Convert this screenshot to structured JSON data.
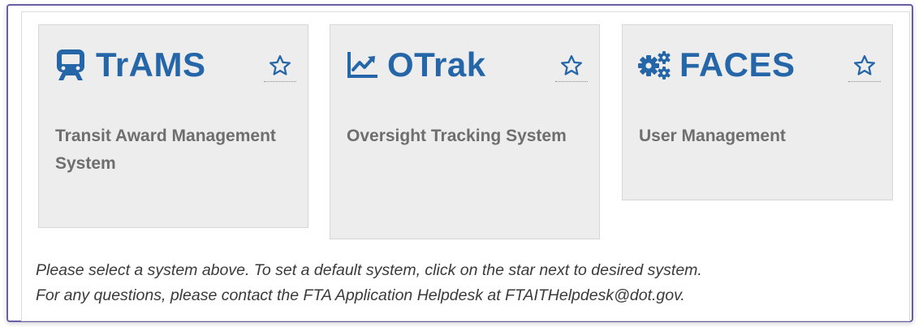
{
  "colors": {
    "accent": "#2566a8",
    "tile_bg": "#ededed",
    "description": "#6e6e6e",
    "frame_border": "#6a5fa6"
  },
  "systems": [
    {
      "title": "TrAMS",
      "icon": "train-icon",
      "description": "Transit Award Management System",
      "favorite": false
    },
    {
      "title": "OTrak",
      "icon": "line-chart-icon",
      "description": "Oversight Tracking System",
      "favorite": false
    },
    {
      "title": "FACES",
      "icon": "gears-icon",
      "description": "User Management",
      "favorite": false
    }
  ],
  "footer": {
    "line1": "Please select a system above. To set a default system, click on the star next to desired system.",
    "line2": "For any questions, please contact the FTA Application Helpdesk at FTAITHelpdesk@dot.gov."
  }
}
